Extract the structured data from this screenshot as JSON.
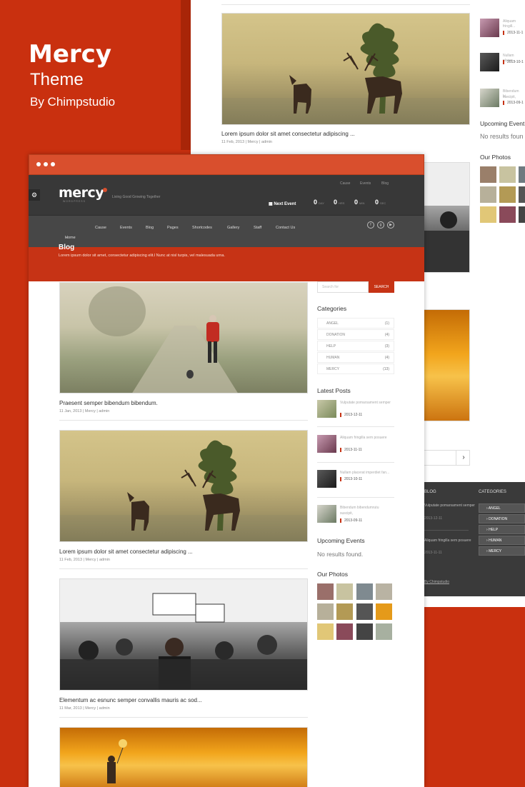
{
  "promo": {
    "title": "Mercy",
    "subtitle": "Theme",
    "by": "By Chimpstudio"
  },
  "back": {
    "post": {
      "title": "Lorem ipsum dolor sit amet consectetur adipiscing ...",
      "date": "11 Feb, 2013",
      "author": "Mercy | admin"
    },
    "latest": [
      {
        "title": "Aliquam fringill...",
        "date": "2013-11-1"
      },
      {
        "title": "Nullam placer...",
        "date": "2013-10-1"
      },
      {
        "title": "Bibendum bi...",
        "title2": "suscipit,",
        "date": "2013-09-1"
      }
    ],
    "upcoming_heading": "Upcoming Event",
    "upcoming_text": "No results foun",
    "photos_heading": "Our Photos",
    "footer": {
      "blog_heading": "BLOG",
      "categories_heading": "CATEGORIES",
      "blog_line": "Vulputate pomarsament semper",
      "blog_date": "2013-12-11",
      "blog_line2": "Aliquam fringilla sem posuere",
      "blog_date2": "2013-11-11",
      "credit": "By Chimpstudio",
      "categories": [
        "ANGEL",
        "DONATION",
        "HELP",
        "HUMAN",
        "MERCY"
      ]
    },
    "next_arrow": "›"
  },
  "window": {
    "logo": "mercy",
    "logo_sub": "WORDPRESS",
    "tagline": "Living Good Growing Together",
    "top_links": [
      "Cause",
      "Events",
      "Blog"
    ],
    "next_event_label": "Next Event",
    "countdown": [
      {
        "value": "0",
        "unit": "DAY"
      },
      {
        "value": "0",
        "unit": "HRS"
      },
      {
        "value": "0",
        "unit": "MIN"
      },
      {
        "value": "0",
        "unit": "SEC"
      }
    ],
    "nav": [
      "Home",
      "Cause",
      "Events",
      "Blog",
      "Pages",
      "Shortcodes",
      "Gallery",
      "Staff",
      "Contact Us"
    ],
    "page_title": "Blog",
    "page_desc": "Lorem ipsum dolor sit amet, consectetur adipiscing elit.l Nunc at nisl turpis, vel malesuada urna.",
    "posts": [
      {
        "title": "Praesent semper bibendum bibendum.",
        "date": "11 Jan, 2013",
        "author": "Mercy | admin"
      },
      {
        "title": "Lorem ipsum dolor sit amet consectetur adipiscing ...",
        "date": "11 Feb, 2013",
        "author": "Mercy | admin"
      },
      {
        "title": "Elementum ac esnunc semper convallis mauris ac sod...",
        "date": "11 Mar, 2013",
        "author": "Mercy | admin"
      }
    ],
    "search": {
      "placeholder": "Search for",
      "button": "SEARCH"
    },
    "categories_heading": "Categories",
    "categories": [
      {
        "name": "ANGEL",
        "count": "(1)"
      },
      {
        "name": "DONATION",
        "count": "(4)"
      },
      {
        "name": "HELP",
        "count": "(3)"
      },
      {
        "name": "HUMAN",
        "count": "(4)"
      },
      {
        "name": "MERCY",
        "count": "(13)"
      }
    ],
    "latest_heading": "Latest Posts",
    "latest": [
      {
        "title": "Vulputate pomarsament semper",
        "title2": "",
        "date": "2013-12-11"
      },
      {
        "title": "Aliquam fringilla sem posuere",
        "title2": "",
        "date": "2013-11-11"
      },
      {
        "title": "Nullam placerat imperdiet fan...",
        "title2": "",
        "date": "2013-10-11"
      },
      {
        "title": "Bibendum bibendumrutu",
        "title2": "suscipit,",
        "date": "2013-09-11"
      }
    ],
    "upcoming_heading": "Upcoming Events",
    "upcoming_text": "No results found.",
    "photos_heading": "Our Photos"
  }
}
